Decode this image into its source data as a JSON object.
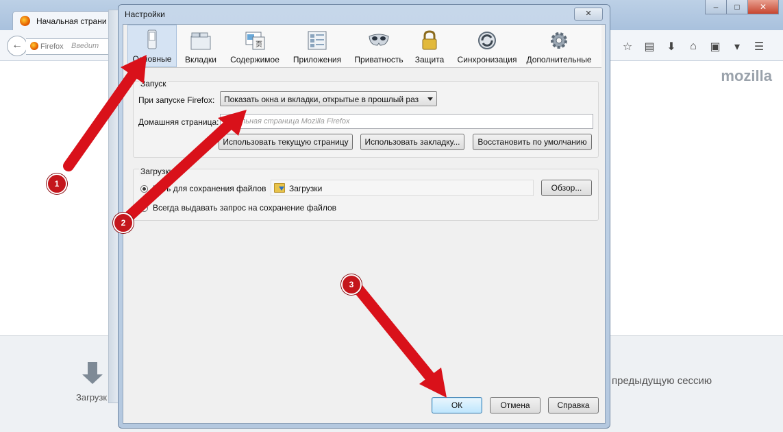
{
  "browser": {
    "tab_title": "Начальная страни",
    "url_prefix": "Firefox",
    "url_placeholder": "Введит",
    "logo": "mozilla",
    "downloads_label": "Загрузк",
    "session_text": "предыдущую сессию",
    "window_controls": [
      "–",
      "□",
      "✕"
    ]
  },
  "dialog": {
    "title": "Настройки",
    "close_symbol": "✕",
    "tabs": [
      {
        "label": "Основные",
        "icon": "switch-icon"
      },
      {
        "label": "Вкладки",
        "icon": "tabs-icon"
      },
      {
        "label": "Содержимое",
        "icon": "content-icon"
      },
      {
        "label": "Приложения",
        "icon": "applications-icon"
      },
      {
        "label": "Приватность",
        "icon": "mask-icon"
      },
      {
        "label": "Защита",
        "icon": "lock-icon"
      },
      {
        "label": "Синхронизация",
        "icon": "sync-icon"
      },
      {
        "label": "Дополнительные",
        "icon": "gear-icon"
      }
    ],
    "startup": {
      "group_title": "Запуск",
      "on_start_label": "При запуске Firefox:",
      "on_start_value": "Показать окна и вкладки, открытые в прошлый раз",
      "homepage_label": "Домашняя страница:",
      "homepage_placeholder": "Начальная страница Mozilla Firefox",
      "btn_current": "Использовать текущую страницу",
      "btn_bookmark": "Использовать закладку...",
      "btn_restore": "Восстановить по умолчанию"
    },
    "downloads": {
      "group_title": "Загрузки",
      "save_path_label": "Путь для сохранения файлов",
      "save_path_value": "Загрузки",
      "browse_btn": "Обзор...",
      "always_ask_label": "Всегда выдавать запрос на сохранение файлов"
    },
    "footer": {
      "ok": "ОК",
      "cancel": "Отмена",
      "help": "Справка"
    }
  },
  "annotations": {
    "badges": [
      "1",
      "2",
      "3"
    ],
    "arrow_color": "#d9111a"
  }
}
